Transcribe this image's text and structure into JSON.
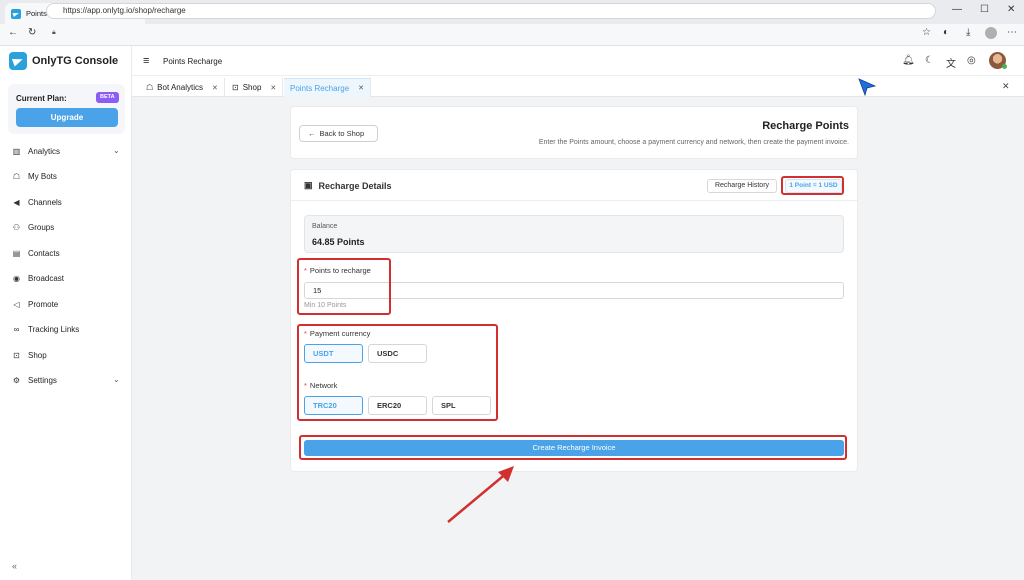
{
  "browser": {
    "tab_title": "Points Recharge - OnlyTG Console",
    "url": "https://app.onlytg.io/shop/recharge"
  },
  "sidebar": {
    "brand": "OnlyTG Console",
    "plan_label": "Current Plan:",
    "plan_badge": "BETA",
    "upgrade_label": "Upgrade",
    "items": [
      {
        "label": "Analytics",
        "icon": "bar-chart-icon"
      },
      {
        "label": "My Bots",
        "icon": "robot-icon"
      },
      {
        "label": "Channels",
        "icon": "megaphone-icon"
      },
      {
        "label": "Groups",
        "icon": "users-icon"
      },
      {
        "label": "Contacts",
        "icon": "contacts-icon"
      },
      {
        "label": "Broadcast",
        "icon": "broadcast-icon"
      },
      {
        "label": "Promote",
        "icon": "promote-icon"
      },
      {
        "label": "Tracking Links",
        "icon": "link-icon"
      },
      {
        "label": "Shop",
        "icon": "shopping-bag-icon"
      },
      {
        "label": "Settings",
        "icon": "gear-icon"
      }
    ],
    "collapse_glyph": "«"
  },
  "header": {
    "title": "Points Recharge"
  },
  "tabs": [
    {
      "label": "Bot Analytics"
    },
    {
      "label": "Shop"
    },
    {
      "label": "Points Recharge"
    }
  ],
  "recharge": {
    "back_label": "Back to Shop",
    "title": "Recharge Points",
    "subtitle": "Enter the Points amount, choose a payment currency and network, then create the payment invoice.",
    "details_title": "Recharge Details",
    "history_label": "Recharge History",
    "rate_label": "1 Point = 1 USD",
    "balance_label": "Balance",
    "balance_value": "64.85 Points",
    "points_label": "Points to recharge",
    "points_value": "15",
    "points_hint": "Min 10 Points",
    "currency_label": "Payment currency",
    "currencies": [
      "USDT",
      "USDC"
    ],
    "selected_currency": "USDT",
    "network_label": "Network",
    "networks": [
      "TRC20",
      "ERC20",
      "SPL"
    ],
    "selected_network": "TRC20",
    "create_label": "Create Recharge Invoice"
  },
  "colors": {
    "accent": "#4aa3e8",
    "highlight": "#d32f2f",
    "beta": "#8b5cf6"
  }
}
